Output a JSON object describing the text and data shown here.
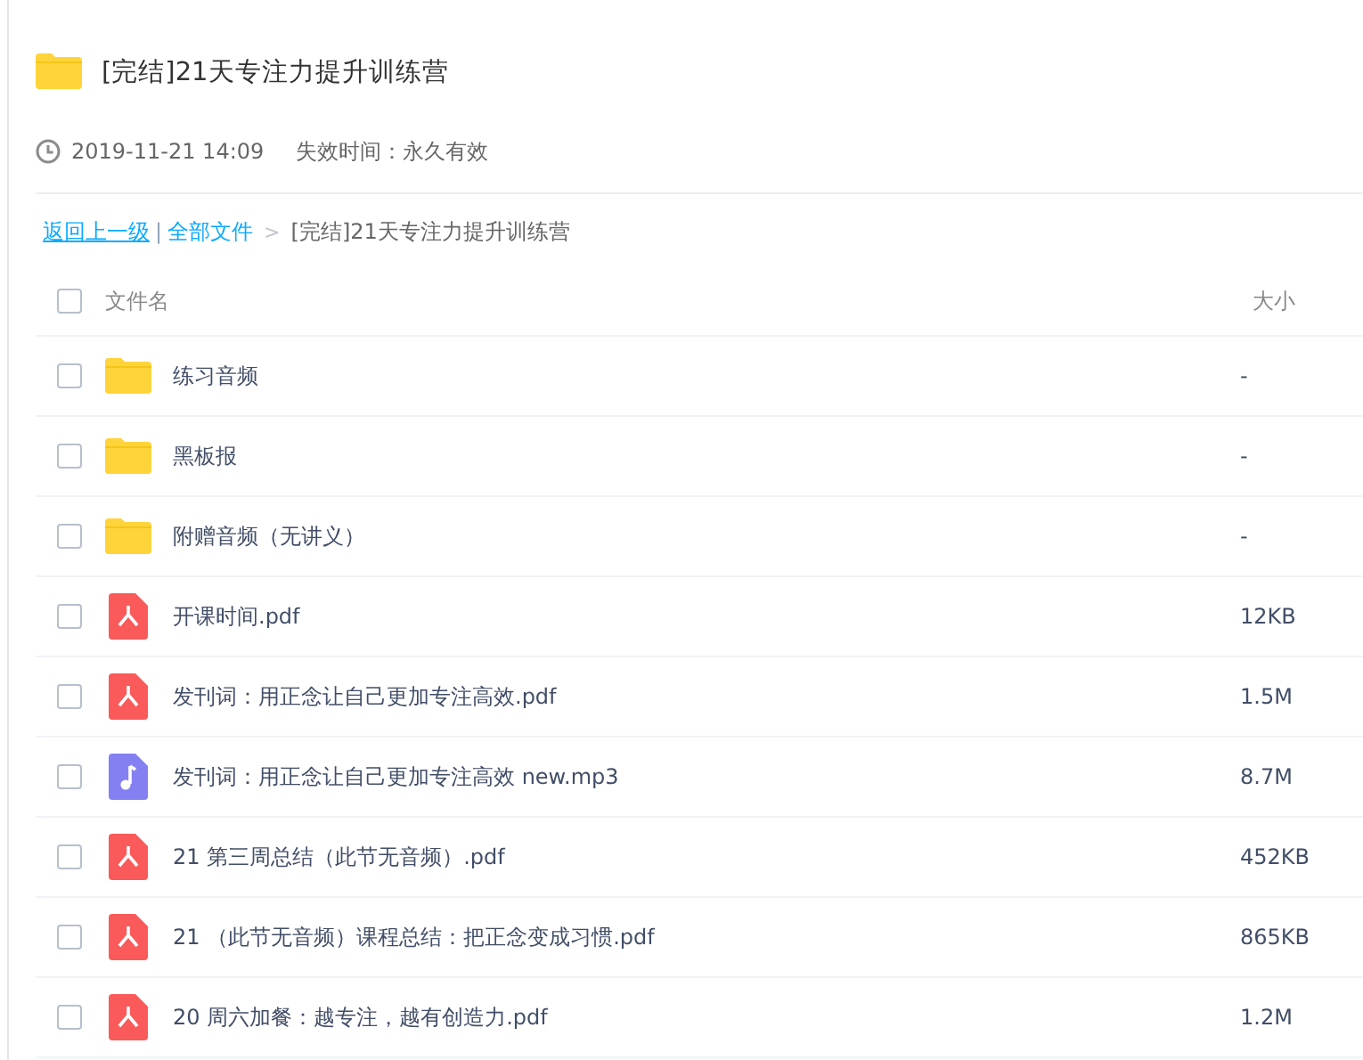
{
  "share": {
    "title": "[完结]21天专注力提升训练营",
    "time": "2019-11-21 14:09",
    "expiry": "失效时间：永久有效"
  },
  "breadcrumb": {
    "back": "返回上一级",
    "separator": "|",
    "root": "全部文件",
    "arrow": ">",
    "current": "[完结]21天专注力提升训练营"
  },
  "table": {
    "columns": [
      "文件名",
      "大小"
    ],
    "select_all": {
      "checked": false
    },
    "rows": [
      {
        "kind": "folder",
        "name": "练习音频",
        "size": "-",
        "checked": false
      },
      {
        "kind": "folder",
        "name": "黑板报",
        "size": "-",
        "checked": false
      },
      {
        "kind": "folder",
        "name": "附赠音频（无讲义）",
        "size": "-",
        "checked": false
      },
      {
        "kind": "pdf",
        "name": "开课时间.pdf",
        "size": "12KB",
        "checked": false
      },
      {
        "kind": "pdf",
        "name": "发刊词：用正念让自己更加专注高效.pdf",
        "size": "1.5M",
        "checked": false
      },
      {
        "kind": "audio",
        "name": "发刊词：用正念让自己更加专注高效 new.mp3",
        "size": "8.7M",
        "checked": false
      },
      {
        "kind": "pdf",
        "name": "21 第三周总结（此节无音频）.pdf",
        "size": "452KB",
        "checked": false
      },
      {
        "kind": "pdf",
        "name": "21 （此节无音频）课程总结：把正念变成习惯.pdf",
        "size": "865KB",
        "checked": false
      },
      {
        "kind": "pdf",
        "name": "20 周六加餐：越专注，越有创造力.pdf",
        "size": "1.2M",
        "checked": false
      }
    ]
  }
}
